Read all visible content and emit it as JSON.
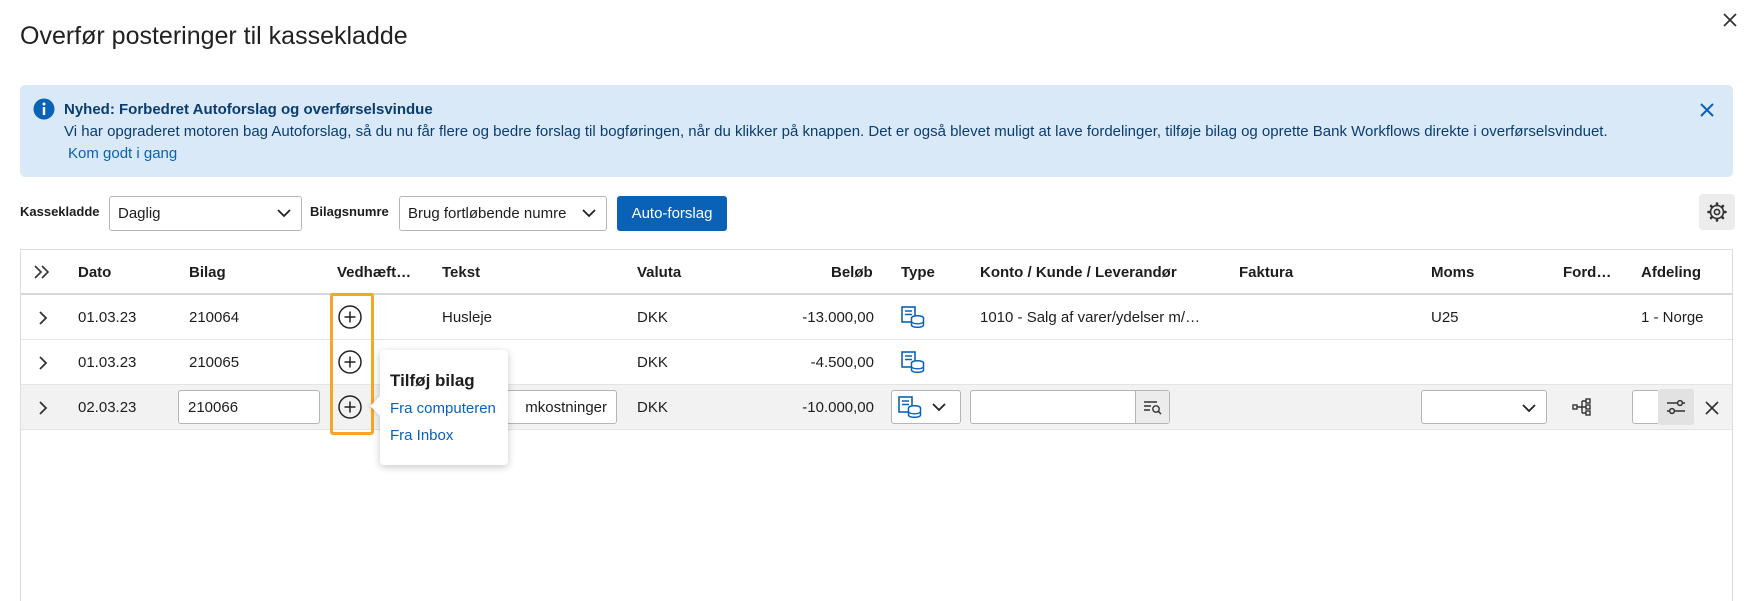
{
  "dialog": {
    "title": "Overfør posteringer til kassekladde"
  },
  "banner": {
    "title": "Nyhed: Forbedret Autoforslag og overførselsvindue",
    "text": "Vi har opgraderet motoren bag Autoforslag, så du nu får flere og bedre forslag til bogføringen, når du klikker på knappen. Det er også blevet muligt at lave fordelinger, tilføje bilag og oprette Bank Workflows direkte i overførselsvinduet.",
    "link": "Kom godt i gang"
  },
  "toolbar": {
    "kassekladde_label": "Kassekladde",
    "kassekladde_value": "Daglig",
    "bilagsnumre_label": "Bilagsnumre",
    "bilagsnumre_value": "Brug fortløbende numre",
    "autoforslag_label": "Auto-forslag"
  },
  "table": {
    "columns": [
      "Dato",
      "Bilag",
      "Vedhæft…",
      "Tekst",
      "Valuta",
      "Beløb",
      "Type",
      "Konto / Kunde / Leverandør",
      "Faktura",
      "Moms",
      "Ford…",
      "Afdeling"
    ],
    "rows": [
      {
        "dato": "01.03.23",
        "bilag": "210064",
        "tekst": "Husleje",
        "valuta": "DKK",
        "belob": "-13.000,00",
        "konto": "1010 - Salg af varer/ydelser m/…",
        "faktura": "",
        "moms": "U25",
        "afdeling": "1 - Norge"
      },
      {
        "dato": "01.03.23",
        "bilag": "210065",
        "tekst": "",
        "valuta": "DKK",
        "belob": "-4.500,00",
        "konto": "",
        "faktura": "",
        "moms": "",
        "afdeling": ""
      },
      {
        "dato": "02.03.23",
        "bilag": "210066",
        "tekst": "mkostninger",
        "valuta": "DKK",
        "belob": "-10.000,00",
        "konto": "",
        "faktura": "",
        "moms": "",
        "afdeling": ""
      }
    ]
  },
  "popover": {
    "title": "Tilføj bilag",
    "items": [
      "Fra computeren",
      "Fra Inbox"
    ]
  },
  "colors": {
    "accent": "#0a62b8",
    "banner_bg": "#d9e9f8",
    "highlight": "#f5a623"
  }
}
